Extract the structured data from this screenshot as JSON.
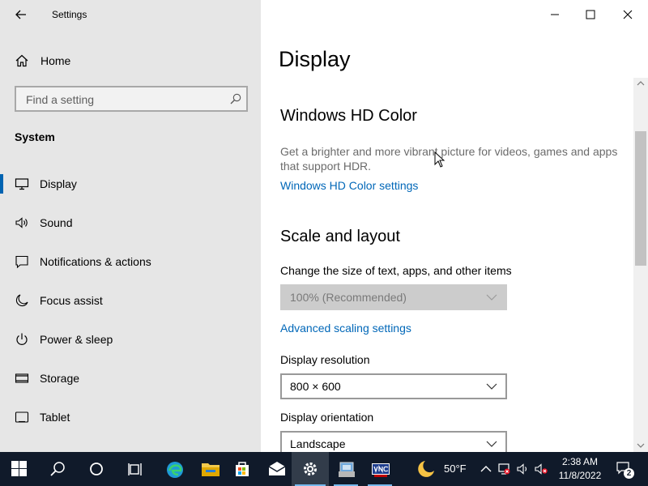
{
  "window": {
    "title": "Settings",
    "controls": {
      "minimize": "minimize",
      "maximize": "maximize",
      "close": "close"
    }
  },
  "sidebar": {
    "home_label": "Home",
    "search": {
      "placeholder": "Find a setting",
      "value": ""
    },
    "section_label": "System",
    "items": [
      {
        "label": "Display",
        "icon": "monitor-icon",
        "active": true
      },
      {
        "label": "Sound",
        "icon": "speaker-icon"
      },
      {
        "label": "Notifications & actions",
        "icon": "notification-icon"
      },
      {
        "label": "Focus assist",
        "icon": "moon-icon"
      },
      {
        "label": "Power & sleep",
        "icon": "power-icon"
      },
      {
        "label": "Storage",
        "icon": "storage-icon"
      },
      {
        "label": "Tablet",
        "icon": "tablet-icon"
      }
    ]
  },
  "content": {
    "page_title": "Display",
    "hd_color": {
      "heading": "Windows HD Color",
      "description": "Get a brighter and more vibrant picture for videos, games and apps that support HDR.",
      "link": "Windows HD Color settings"
    },
    "scale_layout": {
      "heading": "Scale and layout",
      "scale_label": "Change the size of text, apps, and other items",
      "scale_value": "100% (Recommended)",
      "scale_disabled": true,
      "advanced_link": "Advanced scaling settings",
      "resolution_label": "Display resolution",
      "resolution_value": "800 × 600",
      "orientation_label": "Display orientation",
      "orientation_value": "Landscape"
    }
  },
  "taskbar": {
    "apps": [
      "start",
      "search",
      "cortana",
      "task-view",
      "edge",
      "file-explorer",
      "microsoft-store",
      "mail",
      "settings",
      "app-icon",
      "vnc-viewer"
    ],
    "active_app": "settings",
    "weather": {
      "temperature": "50°F",
      "icon": "moon-icon"
    },
    "tray": [
      "chevron-up-icon",
      "network-icon",
      "speaker-icon",
      "microphone-muted-icon"
    ],
    "clock": {
      "time": "2:38 AM",
      "date": "11/8/2022"
    },
    "notifications": {
      "count": "2"
    }
  },
  "colors": {
    "accent": "#0063b1",
    "link": "#0067b8",
    "sidebar_bg": "#e6e6e6",
    "taskbar_bg": "#101a2a"
  }
}
